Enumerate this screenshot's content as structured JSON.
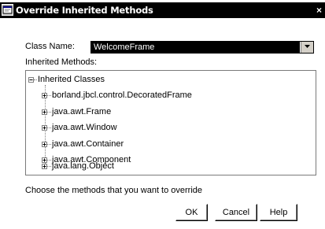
{
  "window": {
    "title": "Override Inherited Methods",
    "close_glyph": "×",
    "icon": "app-window-icon"
  },
  "form": {
    "class_name_label": "Class Name:",
    "class_name_value": "WelcomeFrame",
    "inherited_methods_label": "Inherited Methods:",
    "hint": "Choose the methods that you want to override"
  },
  "tree": {
    "root": {
      "label": "Inherited Classes",
      "expander": "−"
    },
    "children": [
      {
        "label": "borland.jbcl.control.DecoratedFrame",
        "expander": "+"
      },
      {
        "label": "java.awt.Frame",
        "expander": "+"
      },
      {
        "label": "java.awt.Window",
        "expander": "+"
      },
      {
        "label": "java.awt.Container",
        "expander": "+"
      },
      {
        "label": "java.awt.Component",
        "expander": "+"
      },
      {
        "label": "java.lang.Object",
        "expander": "+"
      }
    ]
  },
  "buttons": {
    "ok": "OK",
    "cancel": "Cancel",
    "help": "Help"
  }
}
